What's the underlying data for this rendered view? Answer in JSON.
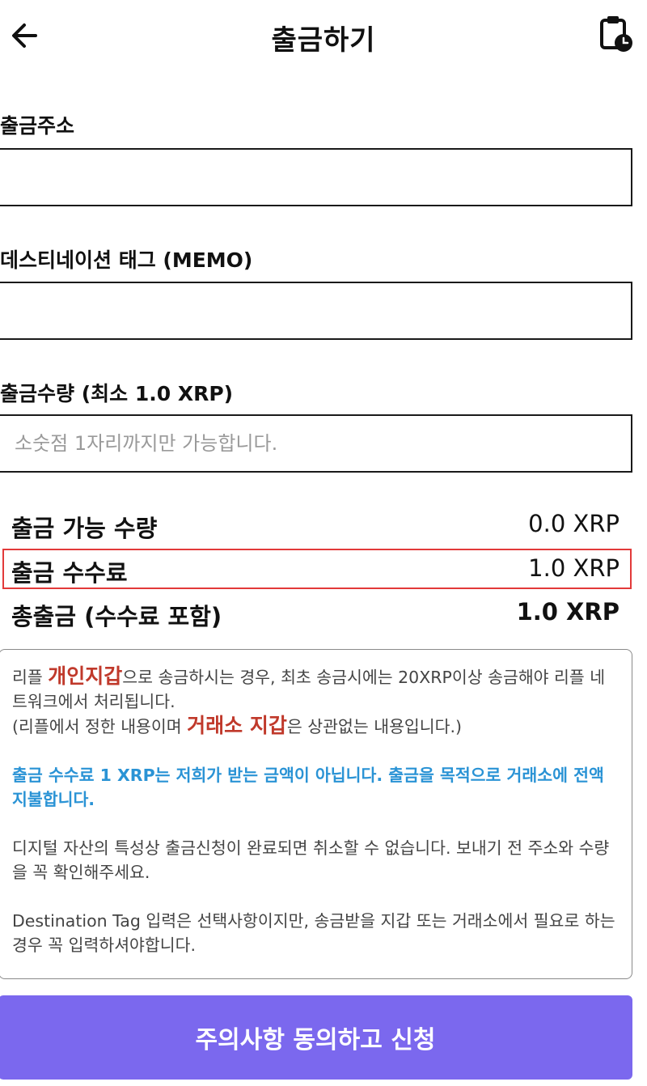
{
  "header": {
    "title": "출금하기",
    "back_icon": "arrow-left-icon",
    "history_icon": "clipboard-clock-icon"
  },
  "form": {
    "address_label": "출금주소",
    "address_value": "",
    "memo_label": "데스티네이션 태그 (MEMO)",
    "memo_value": "",
    "amount_label": "출금수량 (최소 1.0 XRP)",
    "amount_value": "",
    "amount_placeholder": "소숫점 1자리까지만 가능합니다."
  },
  "summary": {
    "available_label": "출금 가능 수량",
    "available_value": "0.0 XRP",
    "fee_label": "출금 수수료",
    "fee_value": "1.0 XRP",
    "total_label": "총출금 (수수료 포함)",
    "total_value": "1.0 XRP"
  },
  "notice": {
    "p1_a": "리플 ",
    "p1_red1": "개인지갑",
    "p1_b": "으로 송금하시는 경우, 최초 송금시에는 20XRP이상 송금해야 리플 네트워크에서 처리됩니다.",
    "p1_c": "(리플에서 정한 내용이며 ",
    "p1_red2": "거래소 지갑",
    "p1_d": "은 상관없는 내용입니다.)",
    "p2": "출금 수수료 1 XRP는 저희가 받는 금액이 아닙니다. 출금을 목적으로 거래소에 전액 지불합니다.",
    "p3": "디지털 자산의 특성상 출금신청이 완료되면 취소할 수 없습니다. 보내기 전 주소와 수량을 꼭 확인해주세요.",
    "p4": "Destination Tag 입력은 선택사항이지만, 송금받을 지갑 또는 거래소에서 필요로 하는 경우 꼭 입력하셔야합니다."
  },
  "submit_label": "주의사항 동의하고 신청",
  "colors": {
    "accent": "#7b68ee",
    "highlight_border": "#e23a3a",
    "notice_red": "#c0392b",
    "notice_blue": "#2a93d5"
  }
}
